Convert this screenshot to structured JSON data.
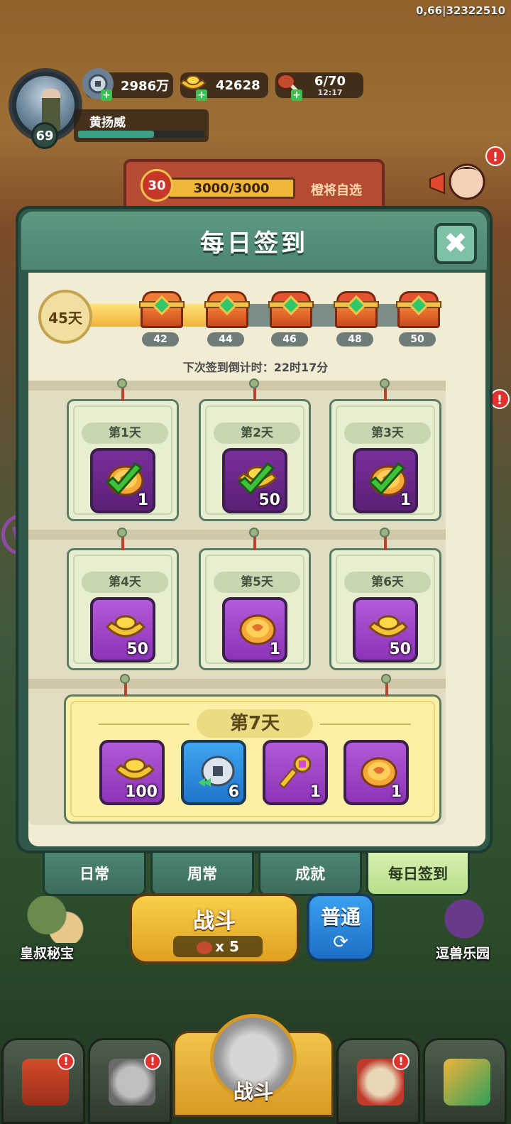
{
  "debug": "0,66|32322510",
  "player": {
    "name": "黄扬威",
    "level": "69",
    "exp_fraction": 0.6
  },
  "resources": {
    "silver": {
      "value": "2986万",
      "icon": "silver-coin-icon"
    },
    "gold": {
      "value": "42628",
      "icon": "gold-ingot-icon"
    },
    "stamina": {
      "value": "6/70",
      "timer": "12:17",
      "icon": "meat-icon"
    }
  },
  "event": {
    "level": "30",
    "progress": "3000/3000",
    "progress_fraction": 1.0,
    "label": "橙将自选"
  },
  "dialog": {
    "title": "每日签到",
    "streak_days": "45天",
    "streak_fraction": 0.45,
    "chests": [
      "42",
      "44",
      "46",
      "48",
      "50"
    ],
    "countdown": "下次签到倒计时：22时17分",
    "days": [
      {
        "label": "第1天",
        "qty": "1",
        "icon": "coin-icon",
        "claimed": true
      },
      {
        "label": "第2天",
        "qty": "50",
        "icon": "gold-ingot-icon",
        "claimed": true
      },
      {
        "label": "第3天",
        "qty": "1",
        "icon": "coin-icon",
        "claimed": true
      },
      {
        "label": "第4天",
        "qty": "50",
        "icon": "gold-ingot-icon",
        "claimed": false
      },
      {
        "label": "第5天",
        "qty": "1",
        "icon": "coin-icon",
        "claimed": false
      },
      {
        "label": "第6天",
        "qty": "50",
        "icon": "gold-ingot-icon",
        "claimed": false
      }
    ],
    "day7": {
      "label": "第7天",
      "rewards": [
        {
          "qty": "100",
          "icon": "gold-ingot-icon"
        },
        {
          "qty": "6",
          "icon": "silver-coin-icon"
        },
        {
          "qty": "1",
          "icon": "key-icon"
        },
        {
          "qty": "1",
          "icon": "coin-icon"
        }
      ]
    },
    "tabs": [
      "日常",
      "周常",
      "成就",
      "每日签到"
    ],
    "active_tab": "每日签到"
  },
  "bottom": {
    "battle": "战斗",
    "battle_cost": "x 5",
    "mode": "普通",
    "left_label": "皇叔秘宝",
    "right_label": "逗兽乐园",
    "nav_center": "战斗"
  }
}
